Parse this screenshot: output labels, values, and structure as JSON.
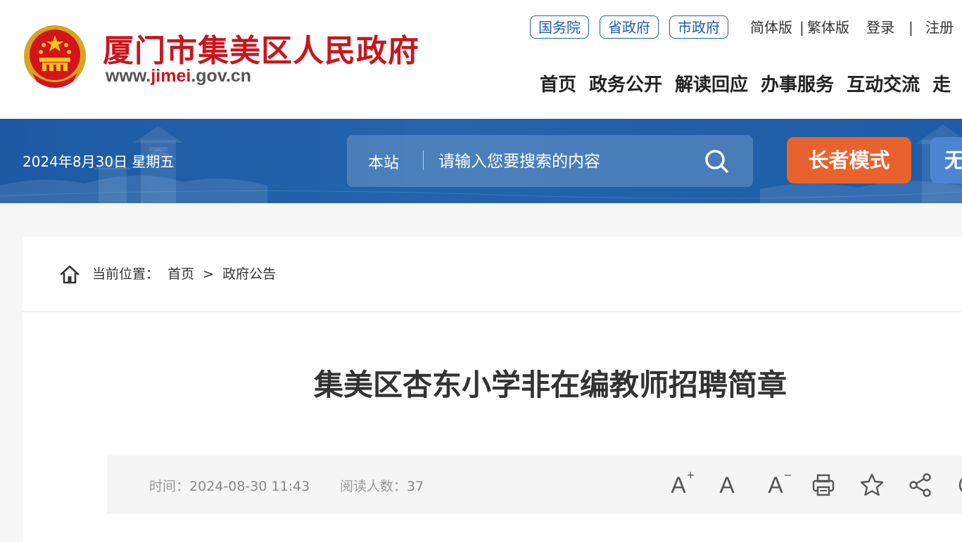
{
  "header": {
    "site_title": "厦门市集美区人民政府",
    "site_url_prefix": "www.",
    "site_url_highlight": "jimei",
    "site_url_suffix": ".gov.cn",
    "emblem_icon": "national-emblem-icon",
    "gov_links": [
      "国务院",
      "省政府",
      "市政府"
    ],
    "lang_simplified": "简体版",
    "lang_separator": "|",
    "lang_traditional": "繁体版",
    "login": "登录",
    "auth_separator": "|",
    "register": "注册",
    "nav": [
      "首页",
      "政务公开",
      "解读回应",
      "办事服务",
      "互动交流",
      "走"
    ]
  },
  "banner": {
    "date": "2024年8月30日 星期五",
    "search_scope": "本站",
    "search_placeholder": "请输入您要搜索的内容",
    "search_icon": "search-icon",
    "elder_mode": "长者模式",
    "access_mode": "无"
  },
  "breadcrumb": {
    "label": "当前位置：",
    "items": [
      "首页",
      ">",
      "政府公告"
    ]
  },
  "article": {
    "title": "集美区杏东小学非在编教师招聘简章",
    "time_label": "时间：",
    "time_value": "2024-08-30 11:43",
    "reads_label": "阅读人数：",
    "reads_value": "37",
    "tools": {
      "font_larger": "A",
      "font_normal": "A",
      "font_smaller": "A"
    }
  },
  "colors": {
    "brand_red": "#c8161d",
    "banner_blue": "#1d5aa3",
    "elder_orange": "#e8622d",
    "link_blue": "#1d5ea8"
  }
}
